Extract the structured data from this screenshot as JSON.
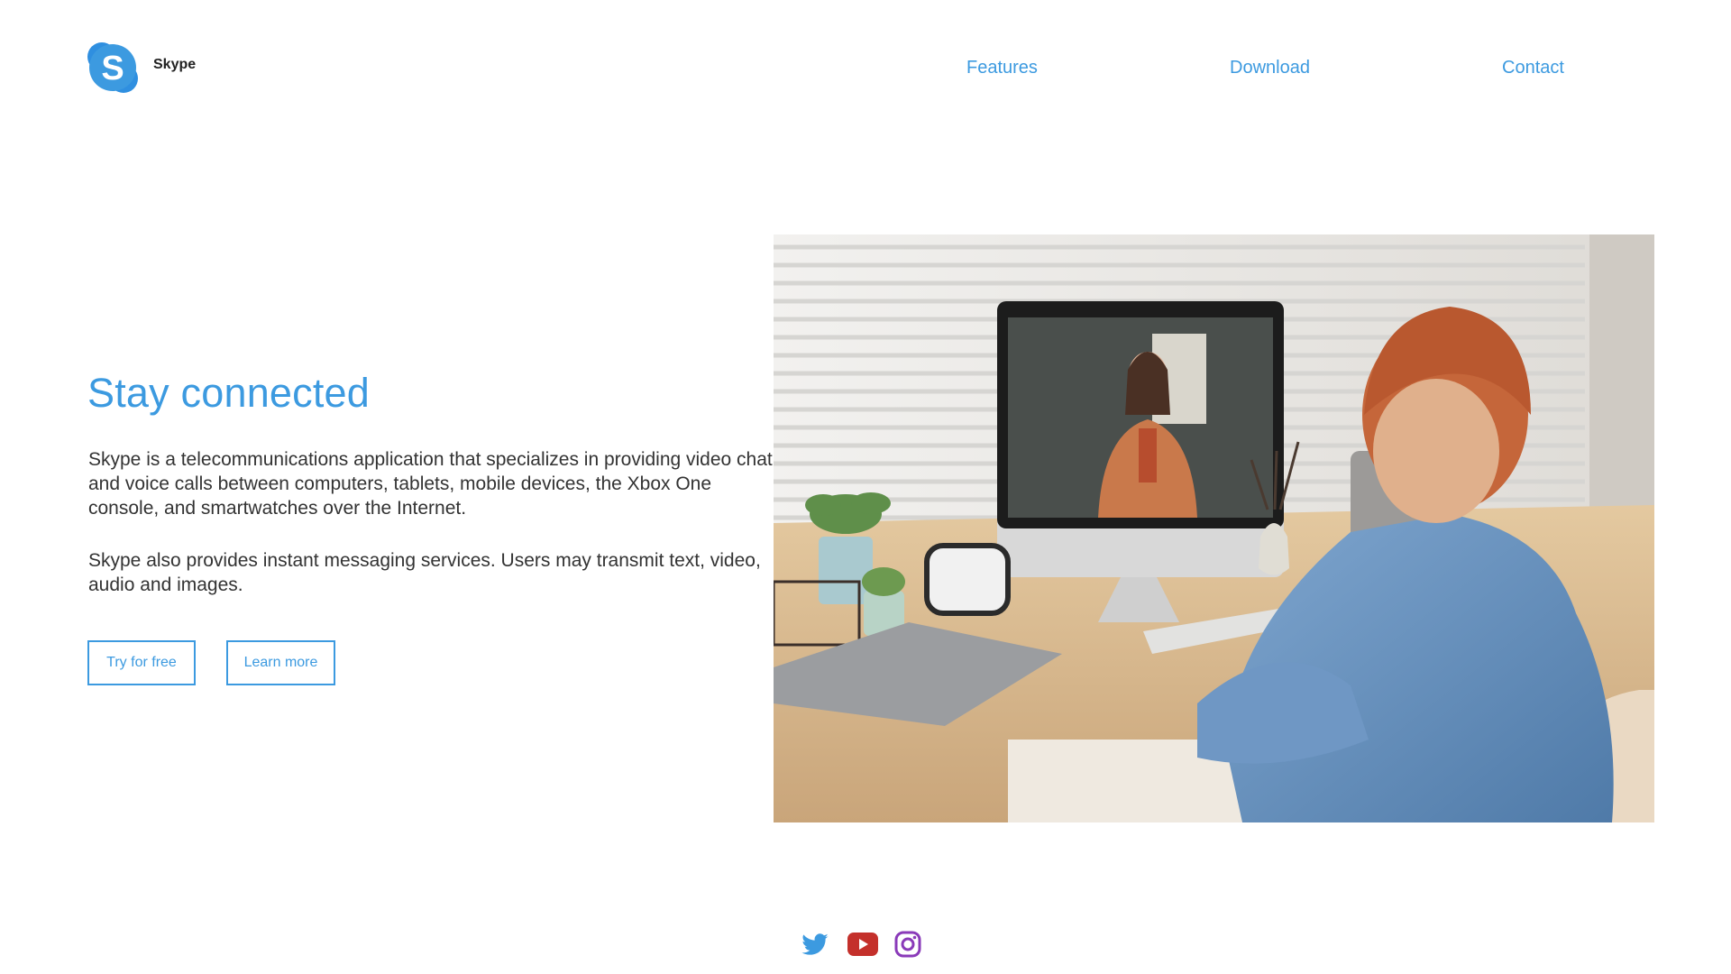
{
  "header": {
    "logo_text": "Skype",
    "logo_icon": "skype-logo-icon",
    "nav": [
      {
        "label": "Features"
      },
      {
        "label": "Download"
      },
      {
        "label": "Contact"
      }
    ]
  },
  "hero": {
    "title": "Stay connected",
    "paragraph1": "Skype is a telecommunications application that specializes in providing video chat and voice calls between computers, tablets, mobile devices, the Xbox One console, and smartwatches over the Internet.",
    "paragraph2": "Skype also provides instant messaging services. Users may transmit text, video, audio and images.",
    "buttons": {
      "try": "Try for free",
      "learn": "Learn more"
    },
    "image": "child-video-call-photo"
  },
  "footer": {
    "socials": [
      "twitter-icon",
      "youtube-icon",
      "instagram-icon"
    ]
  },
  "colors": {
    "accent": "#3c9ae0",
    "text": "#333333",
    "youtube": "#c4302b",
    "instagram": "#8a3ab9"
  }
}
